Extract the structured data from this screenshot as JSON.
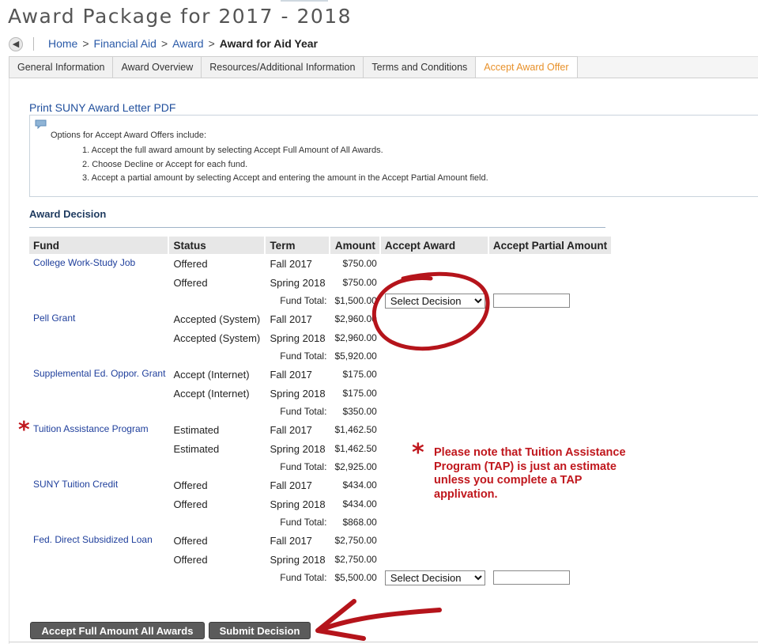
{
  "page_title": "Award Package for 2017 - 2018",
  "breadcrumb": {
    "home": "Home",
    "financial_aid": "Financial Aid",
    "award": "Award",
    "current": "Award for Aid Year",
    "sep": ">"
  },
  "tabs": [
    {
      "label": "General Information"
    },
    {
      "label": "Award Overview"
    },
    {
      "label": "Resources/Additional Information"
    },
    {
      "label": "Terms and Conditions"
    },
    {
      "label": "Accept Award Offer"
    }
  ],
  "print_link": "Print SUNY Award Letter PDF",
  "info": {
    "intro": "Options for Accept Award Offers include:",
    "items": [
      "1. Accept the full award amount by selecting Accept Full Amount of All Awards.",
      "2. Choose Decline or Accept for each fund.",
      "3. Accept a partial amount by selecting Accept and entering the amount in the Accept Partial Amount field."
    ]
  },
  "section_title": "Award Decision",
  "table": {
    "headers": {
      "fund": "Fund",
      "status": "Status",
      "term": "Term",
      "amount": "Amount",
      "accept_award": "Accept Award",
      "accept_partial": "Accept Partial Amount"
    },
    "fund_total_label": "Fund Total:",
    "select_placeholder": "Select Decision",
    "funds": [
      {
        "name": "College Work-Study Job",
        "rows": [
          {
            "status": "Offered",
            "term": "Fall 2017",
            "amount": "$750.00"
          },
          {
            "status": "Offered",
            "term": "Spring 2018",
            "amount": "$750.00"
          }
        ],
        "total": "$1,500.00"
      },
      {
        "name": "Pell Grant",
        "rows": [
          {
            "status": "Accepted (System)",
            "term": "Fall 2017",
            "amount": "$2,960.00"
          },
          {
            "status": "Accepted (System)",
            "term": "Spring 2018",
            "amount": "$2,960.00"
          }
        ],
        "total": "$5,920.00"
      },
      {
        "name": "Supplemental Ed. Oppor. Grant",
        "rows": [
          {
            "status": "Accept (Internet)",
            "term": "Fall 2017",
            "amount": "$175.00"
          },
          {
            "status": "Accept (Internet)",
            "term": "Spring 2018",
            "amount": "$175.00"
          }
        ],
        "total": "$350.00"
      },
      {
        "name": "Tuition Assistance Program",
        "rows": [
          {
            "status": "Estimated",
            "term": "Fall 2017",
            "amount": "$1,462.50"
          },
          {
            "status": "Estimated",
            "term": "Spring 2018",
            "amount": "$1,462.50"
          }
        ],
        "total": "$2,925.00"
      },
      {
        "name": "SUNY Tuition Credit",
        "rows": [
          {
            "status": "Offered",
            "term": "Fall 2017",
            "amount": "$434.00"
          },
          {
            "status": "Offered",
            "term": "Spring 2018",
            "amount": "$434.00"
          }
        ],
        "total": "$868.00"
      },
      {
        "name": "Fed. Direct Subsidized Loan",
        "rows": [
          {
            "status": "Offered",
            "term": "Fall 2017",
            "amount": "$2,750.00"
          },
          {
            "status": "Offered",
            "term": "Spring 2018",
            "amount": "$2,750.00"
          }
        ],
        "total": "$5,500.00"
      }
    ]
  },
  "buttons": {
    "accept_all": "Accept Full Amount All Awards",
    "submit": "Submit Decision"
  },
  "annotation": {
    "asterisk": "*",
    "note": "Please note that Tuition Assistance Program (TAP) is just an estimate unless you complete a TAP applivation."
  },
  "colors": {
    "link": "#1f3f9c",
    "active_tab": "#e8912a",
    "annotation_red": "#c0171d",
    "button_bg": "#5b5b5b",
    "header_bg": "#e7e7e7"
  },
  "icons": {
    "back": "back-arrow-icon",
    "info": "speech-bubble-icon"
  }
}
